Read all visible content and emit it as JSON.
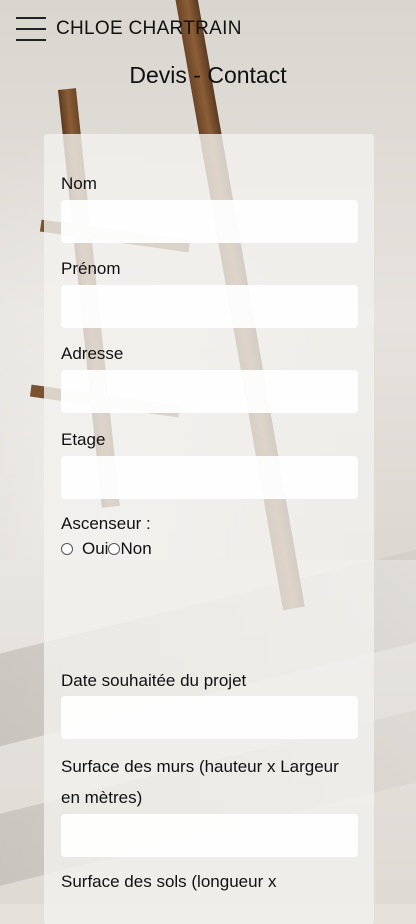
{
  "header": {
    "brand": "CHLOE CHARTRAIN",
    "menu_icon": "hamburger-menu-icon"
  },
  "page": {
    "title": "Devis - Contact"
  },
  "form": {
    "nom_label": "Nom",
    "prenom_label": "Prénom",
    "adresse_label": "Adresse",
    "etage_label": "Etage",
    "ascenseur_label": "Ascenseur :",
    "ascenseur_options": [
      "Oui",
      "Non"
    ],
    "date_label": "Date souhaitée du projet",
    "surface_murs_label": "Surface des murs (hauteur x Largeur en mètres)",
    "surface_sols_label": "Surface des sols (longueur x"
  }
}
